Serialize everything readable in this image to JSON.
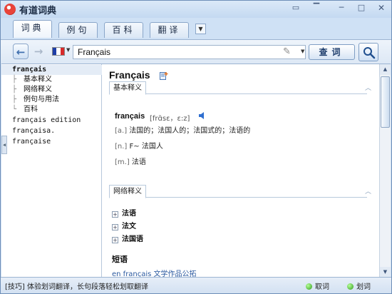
{
  "window": {
    "title": "有道词典",
    "buttons": {
      "mini_mode": "▭",
      "pin": "▔",
      "minimize": "─",
      "maximize": "□",
      "close": "✕"
    }
  },
  "tabs": [
    {
      "label": "词典",
      "active": true
    },
    {
      "label": "例句",
      "active": false
    },
    {
      "label": "百科",
      "active": false
    },
    {
      "label": "翻译",
      "active": false
    }
  ],
  "tabs_more": "▼",
  "toolbar": {
    "back": "←",
    "forward": "→",
    "language_flag": [
      "#1e3fa8",
      "#ffffff",
      "#d82a2a"
    ],
    "search_value": "Français",
    "lookup_label": "查词",
    "icons": [
      "back-arrow-icon",
      "forward-arrow-icon",
      "french-flag-icon",
      "handwriting-pen-icon",
      "magnifier-icon"
    ]
  },
  "sidebar": {
    "rows": [
      {
        "text": "français",
        "selected": true,
        "child": false
      },
      {
        "text": "基本释义",
        "selected": false,
        "child": true,
        "branch": "├"
      },
      {
        "text": "网络释义",
        "selected": false,
        "child": true,
        "branch": "├"
      },
      {
        "text": "例句与用法",
        "selected": false,
        "child": true,
        "branch": "├"
      },
      {
        "text": "百科",
        "selected": false,
        "child": true,
        "branch": "└"
      },
      {
        "text": "français edition",
        "selected": false,
        "child": false
      },
      {
        "text": "françaisa.",
        "selected": false,
        "child": false
      },
      {
        "text": "française",
        "selected": false,
        "child": false
      }
    ]
  },
  "entry": {
    "title": "Français",
    "basic_section": "基本释义",
    "headword": "français",
    "phonetic": "[frɑ̃sɛ，ɛ:z]",
    "definitions": [
      {
        "pos": "[a.]",
        "text": "法国的；法国人的；法国式的；法语的"
      },
      {
        "pos": "[n.]",
        "text": "F~ 法国人"
      },
      {
        "pos": "[m.]",
        "text": "法语"
      }
    ],
    "web_section": "网络释义",
    "web_items": [
      "法语",
      "法文",
      "法国语"
    ],
    "phrases_heading": "短语",
    "phrase_partial": "en français 文学作品公拓"
  },
  "status": {
    "tip": "[技巧] 体验划词翻译，长句段落轻松划取翻译",
    "items": [
      "取词",
      "划词"
    ],
    "indicator_color": "#2f9a1b"
  }
}
